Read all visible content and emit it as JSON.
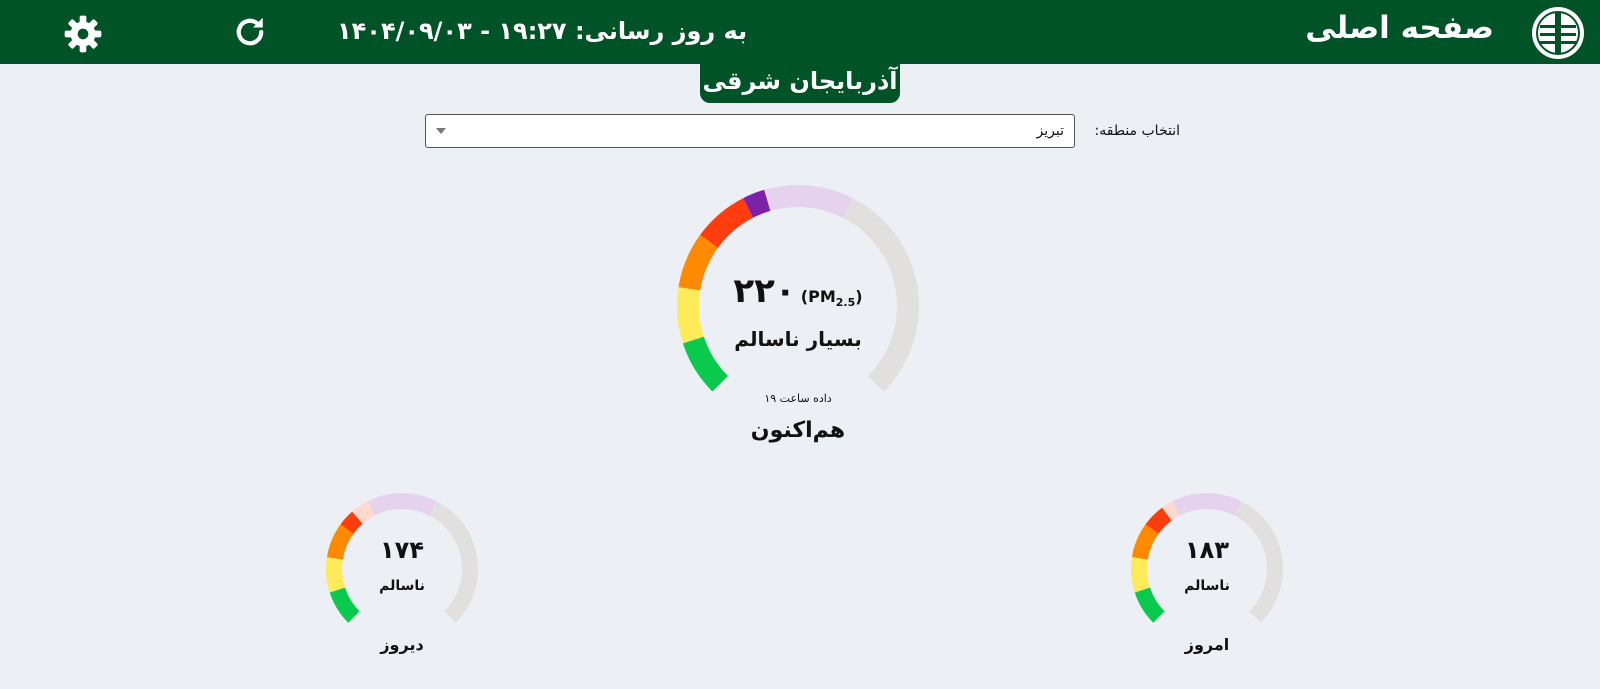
{
  "header": {
    "title": "صفحه اصلی",
    "update_text": "به روز رسانی: ۱۹:۲۷ - ۱۴۰۴/۰۹/۰۳",
    "icons": {
      "logo": "environment-org-logo",
      "refresh": "refresh-icon",
      "settings": "gear-icon"
    }
  },
  "province": {
    "name": "آذربایجان شرقی"
  },
  "region": {
    "label": "انتخاب منطقه:",
    "selected": "تبریز"
  },
  "colors": {
    "header_bg": "#005227",
    "good": "#0ac94d",
    "moderate": "#fdeb5a",
    "usg": "#ff8a00",
    "unhealthy": "#ff3d0f",
    "very_unhealthy": "#7b22a8",
    "hazardous": "#e2e0de"
  },
  "gauges": {
    "now": {
      "value": "۲۲۰",
      "pm_label": "(PM",
      "pm_sub": "2.5",
      "pm_close": ")",
      "status": "بسیار ناسالم",
      "data_hour": "داده ساعت ۱۹",
      "caption": "هم‌اکنون",
      "aqi": 220
    },
    "yesterday": {
      "value": "۱۷۴",
      "status": "ناسالم",
      "caption": "دیروز",
      "aqi": 174
    },
    "today": {
      "value": "۱۸۳",
      "status": "ناسالم",
      "caption": "امروز",
      "aqi": 183
    }
  }
}
